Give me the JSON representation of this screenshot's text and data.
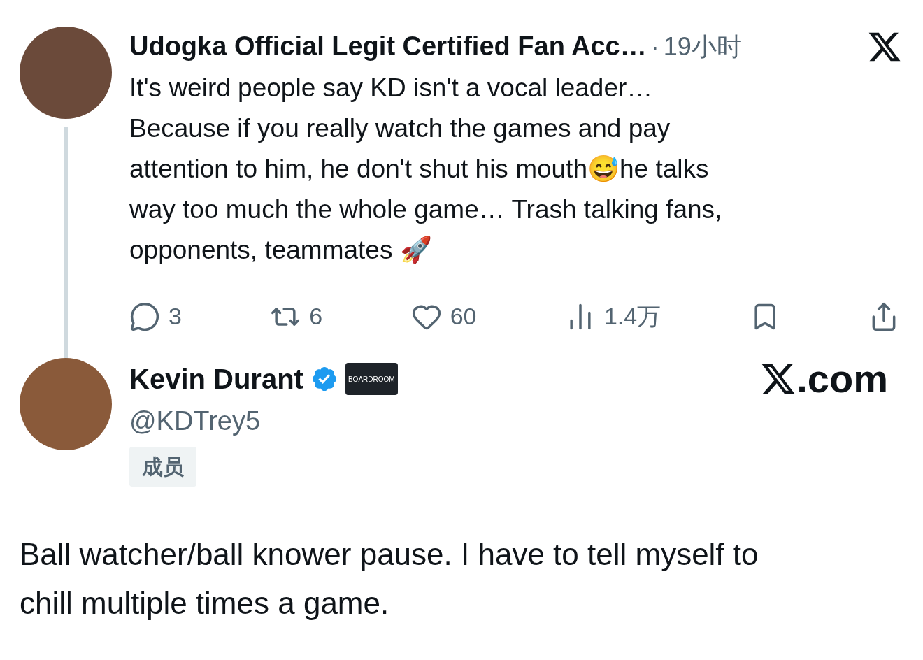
{
  "parent_tweet": {
    "author": "Udogka Official Legit Certified Fan Acc…",
    "separator": "·",
    "time": "19小时",
    "body": "It's weird people say KD isn't a vocal leader…\nBecause if you really watch the games and pay\nattention to him, he don't shut his mouth😅he talks\nway too much the whole game… Trash talking fans,\nopponents, teammates 🚀",
    "actions": [
      {
        "kind": "reply",
        "count": "3"
      },
      {
        "kind": "repost",
        "count": "6"
      },
      {
        "kind": "like",
        "count": "60"
      },
      {
        "kind": "views",
        "count": "1.4万"
      },
      {
        "kind": "bookmark"
      },
      {
        "kind": "share"
      }
    ]
  },
  "reply_author": {
    "name": "Kevin Durant",
    "verified": true,
    "affiliate": "BOARDROOM",
    "handle": "@KDTrey5",
    "tag": "成员",
    "site": ".com"
  },
  "reply_text": "Ball watcher/ball knower pause. I have to tell myself to\nchill multiple times a game."
}
